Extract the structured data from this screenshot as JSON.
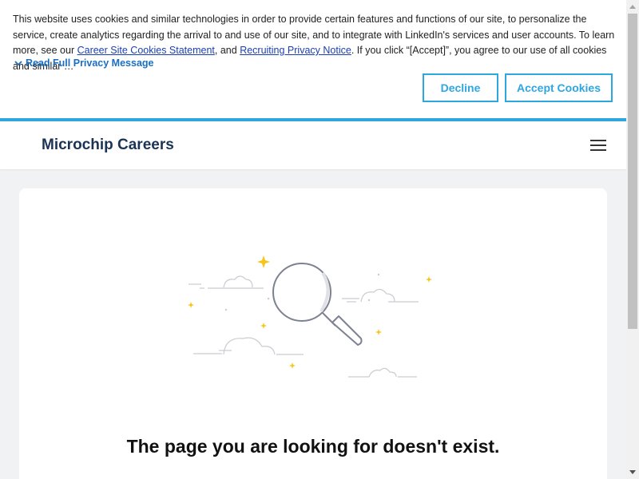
{
  "cookie_banner": {
    "text_part1": "This website uses cookies and similar technologies in order to provide certain features and functions of our site, to personalize the service, create analytics regarding the arrival to and use of our site, and to integrate with LinkedIn's services and user accounts. To learn more, see our ",
    "link1": "Career Site Cookies Statement",
    "text_part2": ", and ",
    "link2": "Recruiting Privacy Notice",
    "text_part3": ". If you click “[Accept]”, you agree to our use of all cookies and similar …",
    "read_full_label": "Read Full Privacy Message",
    "decline_label": "Decline",
    "accept_label": "Accept Cookies",
    "accent_color": "#2ea6e0"
  },
  "header": {
    "brand": "Microchip Careers",
    "menu_icon": "hamburger-menu-icon"
  },
  "main": {
    "illustration_icon": "magnifying-glass-icon",
    "error_title": "The page you are looking for doesn't exist."
  }
}
